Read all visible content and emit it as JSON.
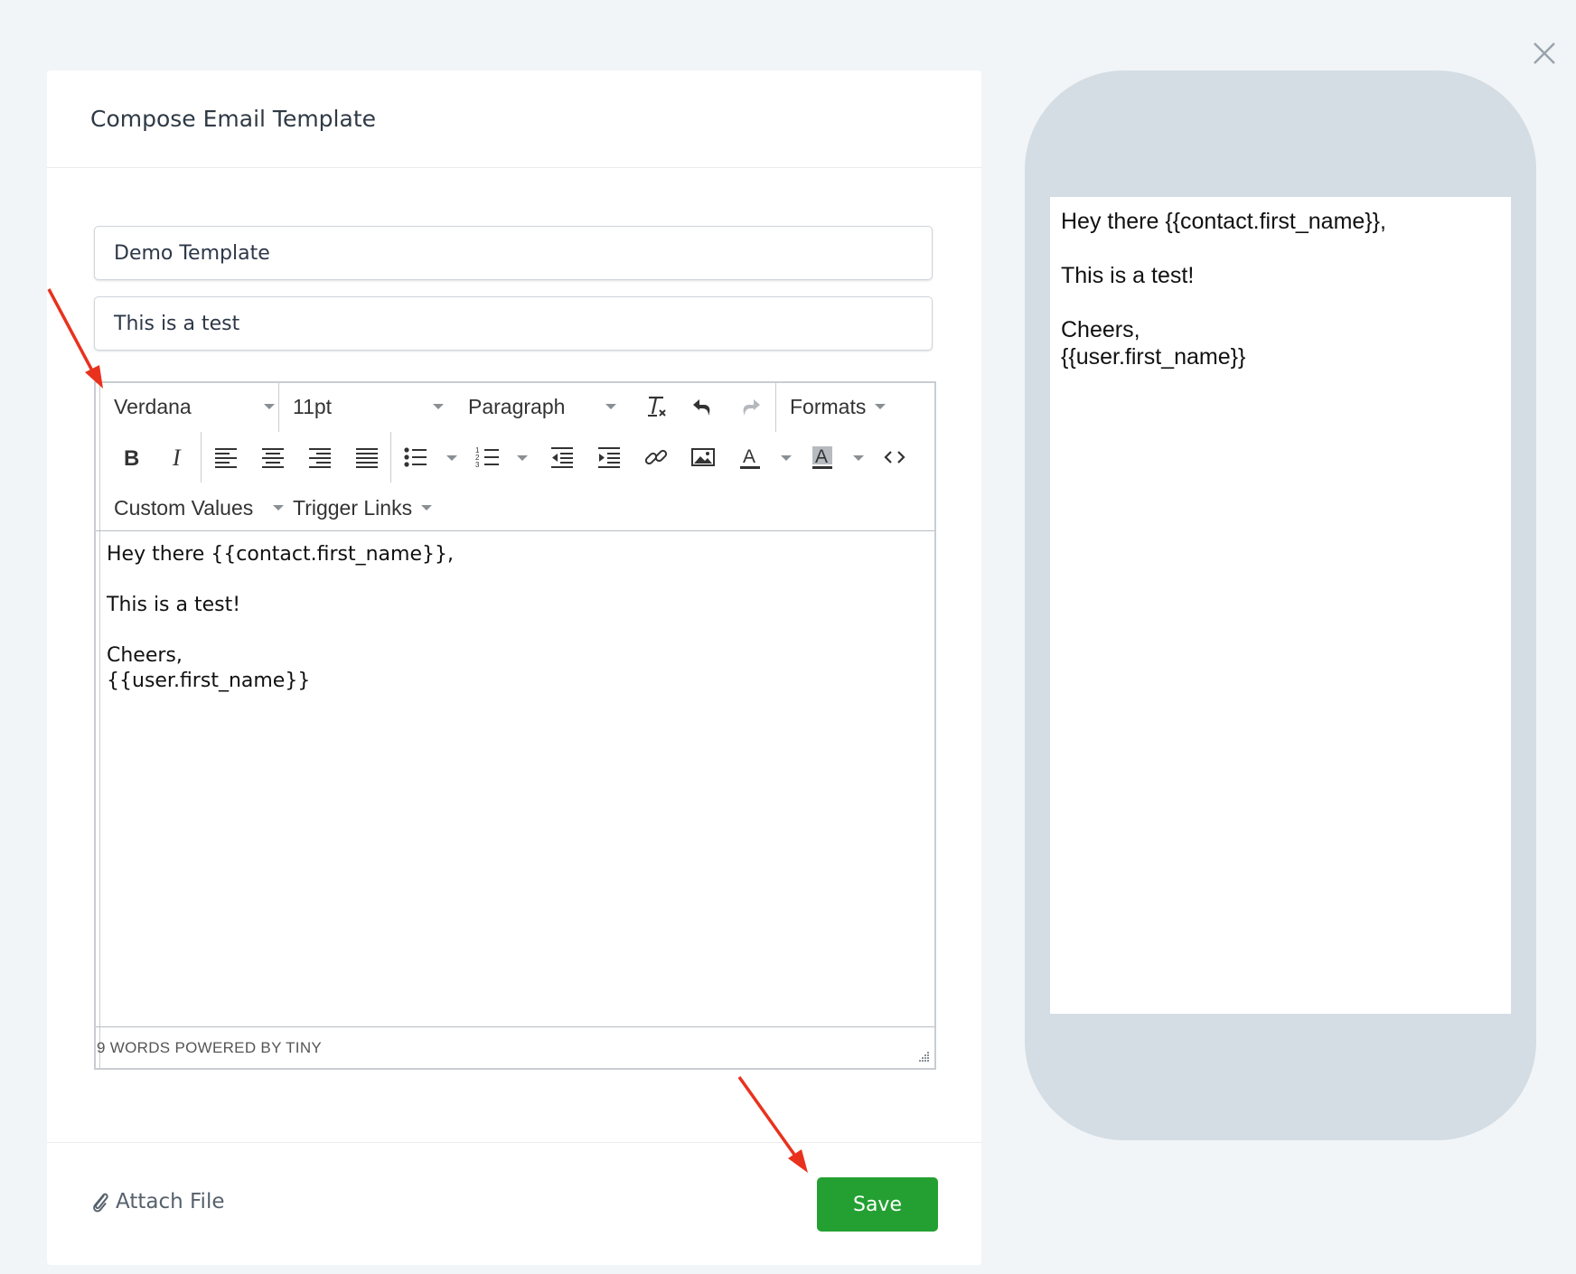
{
  "modal": {
    "title": "Compose Email Template"
  },
  "form": {
    "template_name": "Demo Template",
    "subject": "This is a test"
  },
  "toolbar": {
    "font_family": "Verdana",
    "font_size": "11pt",
    "block_format": "Paragraph",
    "formats_menu": "Formats",
    "custom_values_menu": "Custom Values",
    "trigger_links_menu": "Trigger Links"
  },
  "editor": {
    "lines": [
      "Hey there {{contact.first_name}},",
      "This is a test!",
      "Cheers,",
      "{{user.first_name}}"
    ],
    "status": "9 WORDS POWERED BY TINY"
  },
  "footer": {
    "attach_label": "Attach File",
    "save_label": "Save"
  },
  "preview": {
    "lines": [
      "Hey there {{contact.first_name}},",
      "This is a test!",
      "Cheers,",
      "{{user.first_name}}"
    ]
  },
  "colors": {
    "save_button": "#24a032",
    "annotation_arrow": "#e8321e",
    "phone_frame": "#d4dde4"
  }
}
